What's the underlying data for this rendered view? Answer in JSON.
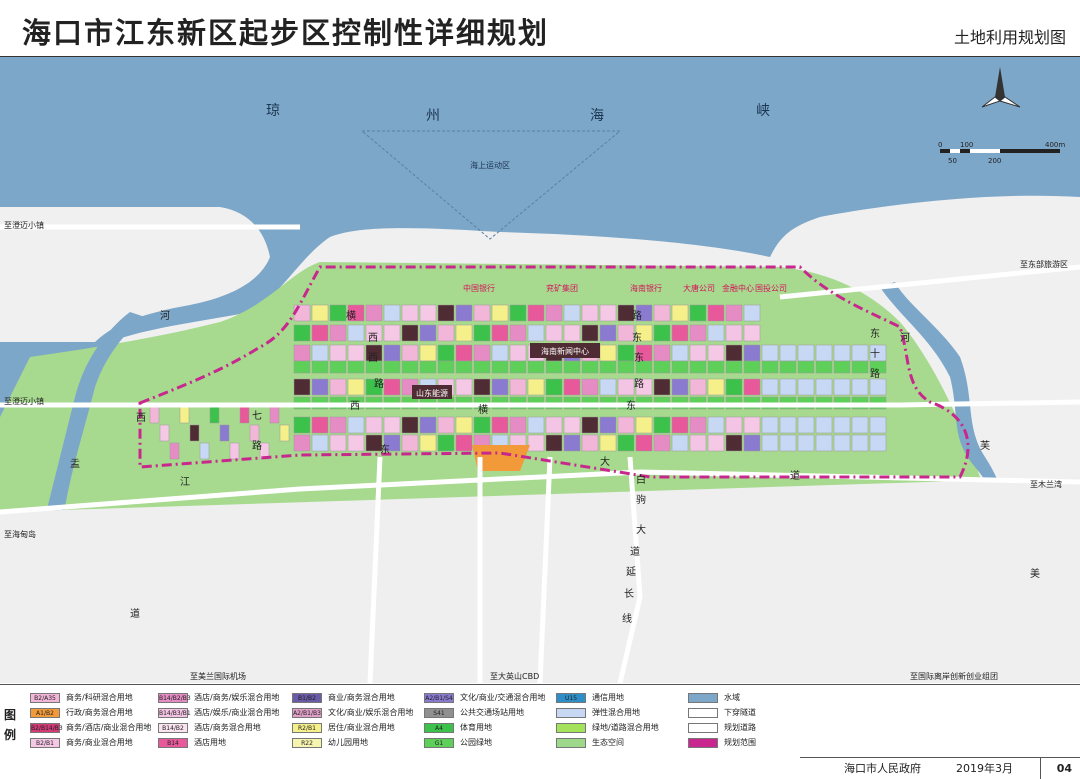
{
  "header": {
    "title": "海口市江东新区起步区控制性详细规划",
    "subtitle": "土地利用规划图"
  },
  "map": {
    "sea_chars": [
      "琼",
      "州",
      "海",
      "峡"
    ],
    "sea_area": "海上运动区",
    "scale": {
      "ticks_top": [
        "0",
        "100",
        "400m"
      ],
      "ticks_bottom": [
        "50",
        "200"
      ]
    },
    "companies": [
      "中国银行",
      "兖矿集团",
      "海南银行",
      "大唐公司",
      "金融中心",
      "国投公司"
    ],
    "landmarks": {
      "news": "海南新闻中心",
      "energy": "山东能源"
    },
    "destinations": {
      "chengmai_top": "至澄迈小镇",
      "chengmai_mid": "至澄迈小镇",
      "haidian": "至海甸岛",
      "east_resort": "至东部旅游区",
      "zhimuLan": "至木兰湾",
      "meilan": "至美兰国际机场",
      "daying": "至大英山CBD",
      "innovation": "至国际离岸创新创业组团"
    },
    "road_chars": {
      "heng_west": [
        "横",
        "西",
        "西",
        "路",
        "西",
        "横"
      ],
      "heng_east": [
        "路",
        "东",
        "东",
        "路",
        "东"
      ],
      "west_ring": [
        "西",
        "七",
        "路"
      ],
      "east_ring": [
        "东",
        "十",
        "路"
      ],
      "dadao": [
        "东",
        "大",
        "道"
      ],
      "jiang": [
        "江"
      ],
      "baiju": [
        "白",
        "驹",
        "大",
        "道",
        "延",
        "长",
        "线"
      ],
      "river_w": [
        "河",
        "盂",
        "道"
      ],
      "river_e": [
        "河",
        "芙",
        "美"
      ]
    },
    "zones": [
      "A4",
      "B2/A35",
      "B2/B1",
      "B14/B2/B1",
      "A2/B1/S4",
      "B14",
      "R2/B1",
      "B1/B2",
      "G1",
      "A35",
      "R22",
      "A2/B1",
      "B14/B3/B1",
      "B1/A35",
      "S41",
      "A1/B2"
    ]
  },
  "legend": {
    "head": "图例",
    "items": [
      {
        "code": "B2/A35",
        "label": "商务/科研混合用地",
        "color": "#f2b6d9"
      },
      {
        "code": "A1/B2",
        "label": "行政/商务混合用地",
        "color": "#f29a3a"
      },
      {
        "code": "B2/B14/B3",
        "label": "商务/酒店/商业混合用地",
        "color": "#d43a78"
      },
      {
        "code": "B2/B1",
        "label": "商务/商业混合用地",
        "color": "#f5c8e6"
      },
      {
        "code": "B14/B2/B3",
        "label": "酒店/商务/娱乐混合用地",
        "color": "#e58cc4"
      },
      {
        "code": "B14/B3/B1",
        "label": "酒店/娱乐/商业混合用地",
        "color": "#f4c4e4"
      },
      {
        "code": "B14/B2",
        "label": "酒店/商务混合用地",
        "color": "#fbe3f1"
      },
      {
        "code": "B14",
        "label": "酒店用地",
        "color": "#e8599b"
      },
      {
        "code": "B1/B2",
        "label": "商业/商务混合用地",
        "color": "#6a5aa8"
      },
      {
        "code": "A2/B1/B3",
        "label": "文化/商业/娱乐混合用地",
        "color": "#e0a0c8"
      },
      {
        "code": "R2/B1",
        "label": "居住/商业混合用地",
        "color": "#f5f08a"
      },
      {
        "code": "R22",
        "label": "幼儿园用地",
        "color": "#f7f4b0"
      },
      {
        "code": "A2/B1/S4",
        "label": "文化/商业/交通混合用地",
        "color": "#8a7ad0"
      },
      {
        "code": "S41",
        "label": "公共交通场站用地",
        "color": "#909090"
      },
      {
        "code": "A4",
        "label": "体育用地",
        "color": "#3cc24a"
      },
      {
        "code": "G1",
        "label": "公园绿地",
        "color": "#5ed05a"
      },
      {
        "code": "U15",
        "label": "通信用地",
        "color": "#2e8fc8"
      },
      {
        "code": "",
        "label": "弹性混合用地",
        "color": "#c6d8f4"
      },
      {
        "code": "",
        "label": "绿地/道路混合用地",
        "color": "#a4e25c"
      },
      {
        "code": "",
        "label": "生态空间",
        "color": "#9ed88a"
      },
      {
        "code": "",
        "label": "水域",
        "color": "#7da7c9"
      },
      {
        "code": "",
        "label": "下穿隧道",
        "color": "#ffffff"
      },
      {
        "code": "",
        "label": "规划道路",
        "color": "#ffffff"
      },
      {
        "code": "",
        "label": "规划范围",
        "color": "#c8288e"
      }
    ]
  },
  "footer": {
    "org": "海口市人民政府",
    "date": "2019年3月",
    "page": "04"
  },
  "colors": {
    "water": "#7da7c9",
    "land": "#eeeeee",
    "eco": "#9ed88a",
    "boundary": "#c8288e",
    "road": "#ffffff",
    "company_label": "#d4145a",
    "road_char": "#222222"
  }
}
